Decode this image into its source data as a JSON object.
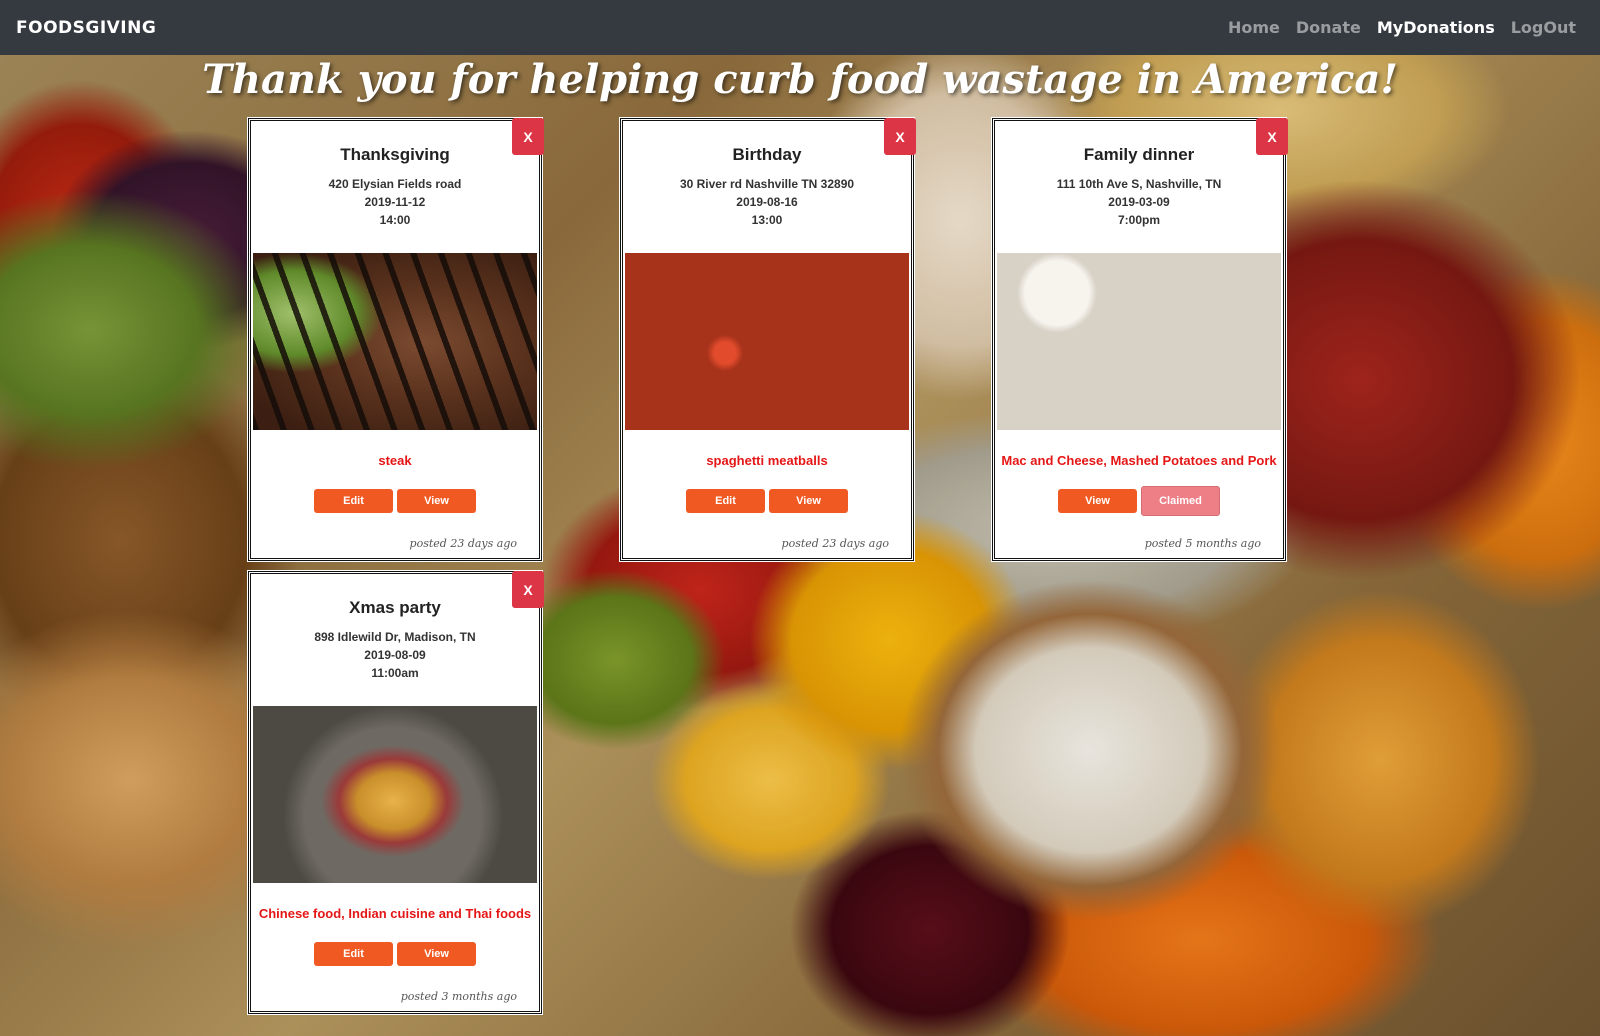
{
  "nav": {
    "brand": "FOODSGIVING",
    "links": [
      {
        "label": "Home"
      },
      {
        "label": "Donate"
      },
      {
        "label": "MyDonations"
      },
      {
        "label": "LogOut"
      }
    ]
  },
  "hero": {
    "title": "Thank you for helping curb food wastage in America!"
  },
  "cards": [
    {
      "close": "X",
      "title": "Thanksgiving",
      "address": "420 Elysian Fields road",
      "date": "2019-11-12",
      "time": "14:00",
      "food": "steak",
      "btn1": "Edit",
      "btn2": "View",
      "posted": "posted 23 days ago"
    },
    {
      "close": "X",
      "title": "Birthday",
      "address": "30 River rd Nashville TN 32890",
      "date": "2019-08-16",
      "time": "13:00",
      "food": "spaghetti meatballs",
      "btn1": "Edit",
      "btn2": "View",
      "posted": "posted 23 days ago"
    },
    {
      "close": "X",
      "title": "Family dinner",
      "address": "111 10th Ave S, Nashville, TN",
      "date": "2019-03-09",
      "time": "7:00pm",
      "food": "Mac and Cheese, Mashed Potatoes and Pork",
      "btn1": "View",
      "btn2": "Claimed",
      "posted": "posted 5 months ago"
    },
    {
      "close": "X",
      "title": "Xmas party",
      "address": "898 Idlewild Dr, Madison, TN",
      "date": "2019-08-09",
      "time": "11:00am",
      "food": "Chinese food, Indian cuisine and Thai foods",
      "btn1": "Edit",
      "btn2": "View",
      "posted": "posted 3 months ago"
    }
  ]
}
